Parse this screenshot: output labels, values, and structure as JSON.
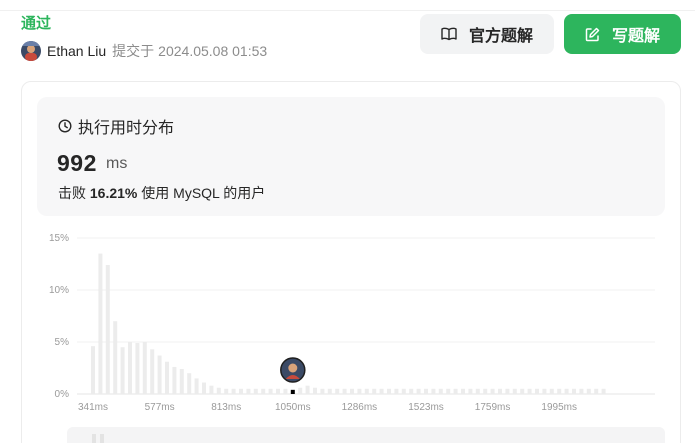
{
  "submission": {
    "status": "通过",
    "author": "Ethan Liu",
    "submitted_label": "提交于",
    "timestamp": "2024.05.08 01:53"
  },
  "buttons": {
    "official_label": "官方题解",
    "write_label": "写题解"
  },
  "runtime": {
    "title": "执行用时分布",
    "value": "992",
    "unit": "ms",
    "beats_prefix": "击败",
    "beats_percent": "16.21%",
    "beats_suffix": "使用 MySQL 的用户"
  },
  "icons": {
    "status": "none",
    "book": "book-open-icon",
    "write": "pencil-square-icon",
    "clock": "clock-icon"
  },
  "colors": {
    "accent": "#2db55d",
    "bar": "#ececec",
    "user_bar": "#000000"
  },
  "chart_data": {
    "type": "bar",
    "ylim": [
      0,
      15
    ],
    "yticks": [
      "15%",
      "10%",
      "5%",
      "0%"
    ],
    "x_tick_labels": [
      "341ms",
      "577ms",
      "813ms",
      "1050ms",
      "1286ms",
      "1523ms",
      "1759ms",
      "1995ms"
    ],
    "x_tick_bins": [
      0,
      9,
      18,
      27,
      36,
      45,
      54,
      63
    ],
    "values": [
      4.6,
      13.5,
      12.4,
      7.0,
      4.5,
      5.0,
      4.9,
      5.0,
      4.3,
      3.7,
      3.1,
      2.6,
      2.4,
      2.0,
      1.5,
      1.1,
      0.8,
      0.6,
      0.5,
      0.5,
      0.5,
      0.5,
      0.5,
      0.5,
      0.5,
      0.5,
      0.5,
      0.4,
      0.6,
      0.8,
      0.6,
      0.5,
      0.5,
      0.5,
      0.5,
      0.5,
      0.5,
      0.5,
      0.5,
      0.5,
      0.5,
      0.5,
      0.5,
      0.5,
      0.5,
      0.5,
      0.5,
      0.5,
      0.5,
      0.5,
      0.5,
      0.5,
      0.5,
      0.5,
      0.5,
      0.5,
      0.5,
      0.5,
      0.5,
      0.5,
      0.5,
      0.5,
      0.5,
      0.5,
      0.5,
      0.5,
      0.5,
      0.5,
      0.5,
      0.5
    ],
    "user_bin": 27,
    "grid": true,
    "legend": "none"
  }
}
